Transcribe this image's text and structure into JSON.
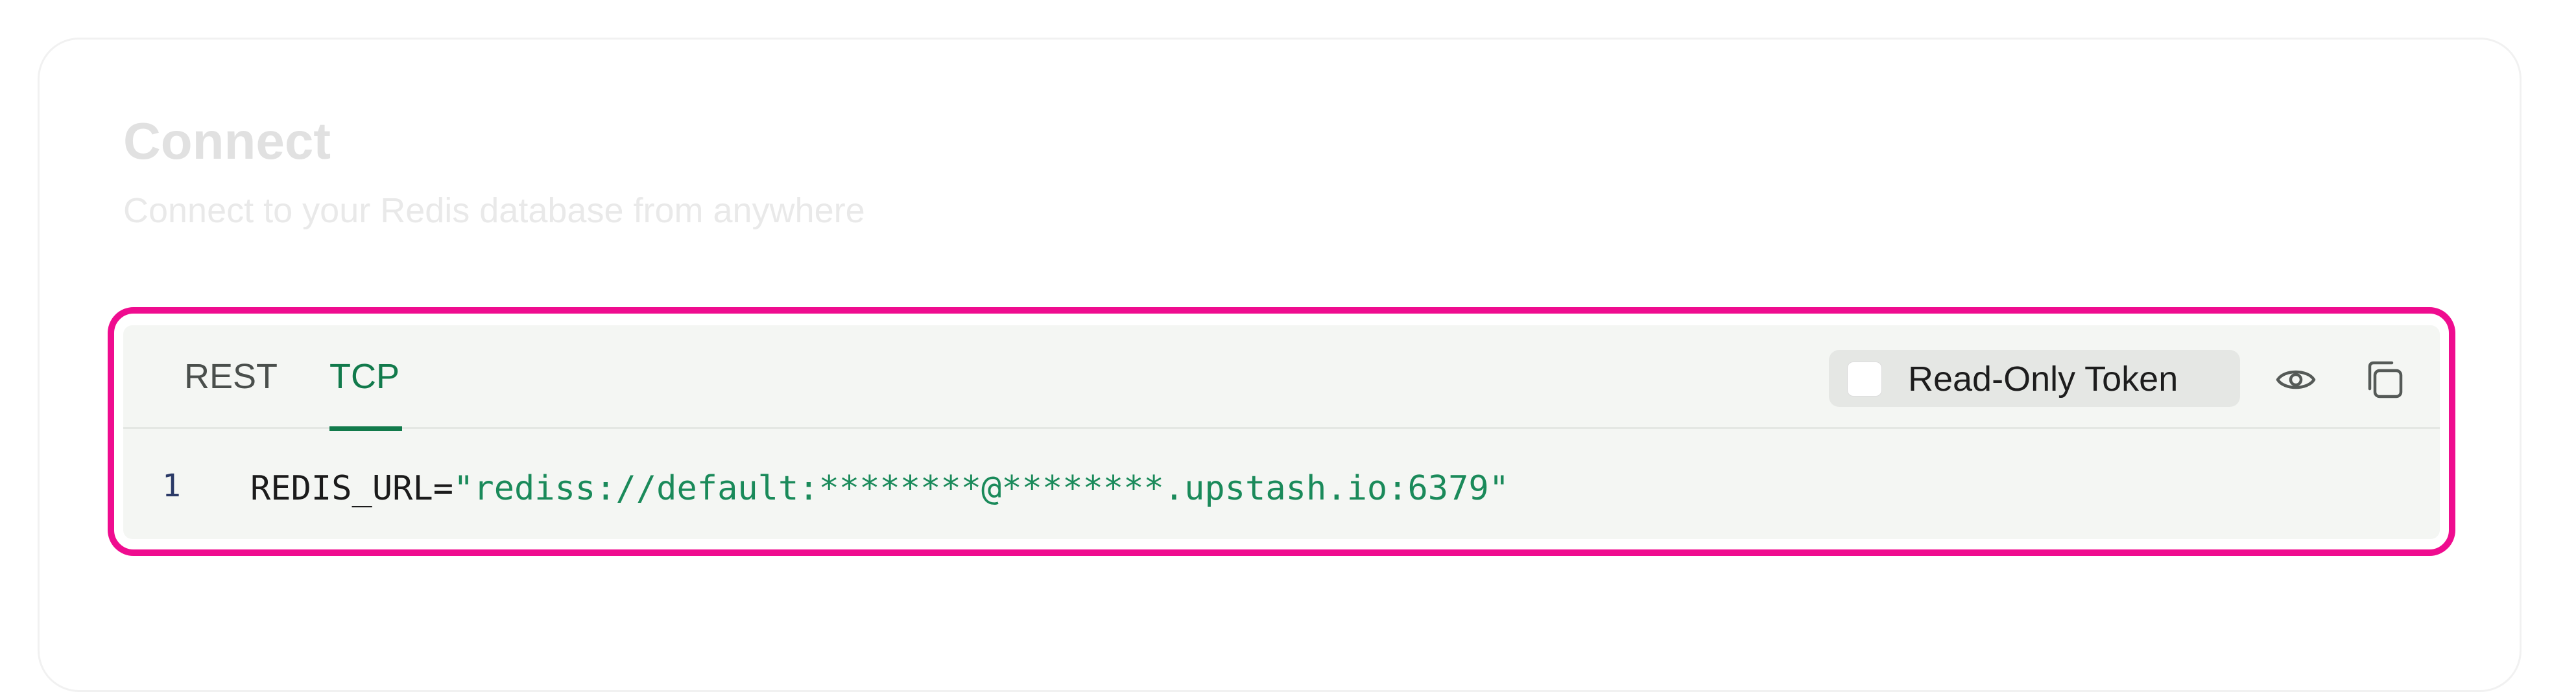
{
  "header": {
    "title": "Connect",
    "subtitle": "Connect to your Redis database from anywhere"
  },
  "tabs": [
    {
      "label": "REST",
      "active": false
    },
    {
      "label": "TCP",
      "active": true
    }
  ],
  "read_only_token": {
    "label": "Read-Only Token",
    "checked": false
  },
  "icons": {
    "reveal": "eye-icon",
    "copy": "copy-icon"
  },
  "code": {
    "line_number": "1",
    "key": "REDIS_URL",
    "equals": "=",
    "value": "\"rediss://default:********@********.upstash.io:6379\""
  },
  "colors": {
    "accent": "#117a4b",
    "highlight_border": "#ef0c8f",
    "string": "#1a8a5a"
  }
}
